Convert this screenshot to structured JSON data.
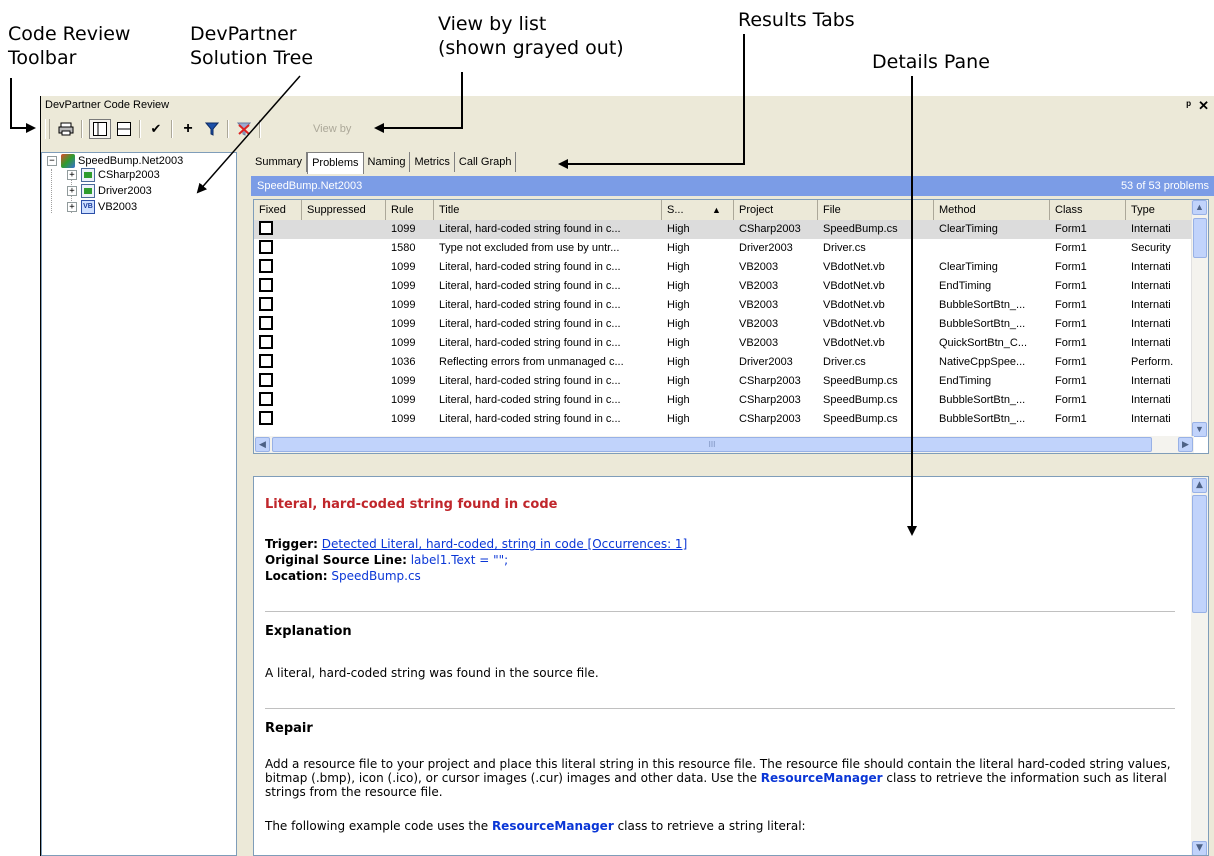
{
  "callouts": {
    "toolbar": [
      "Code Review",
      "Toolbar"
    ],
    "tree": [
      "DevPartner",
      "Solution Tree"
    ],
    "viewby": [
      "View by list",
      "(shown grayed out)"
    ],
    "tabs": "Results Tabs",
    "details": "Details Pane"
  },
  "window": {
    "title": "DevPartner Code Review",
    "pin_glyph": "ᵖ",
    "close_glyph": "✕"
  },
  "toolbar": {
    "view_by_label": "View by",
    "icons": [
      "printer-icon",
      "split-vertical-icon",
      "split-horizontal-icon",
      "checkmark-icon",
      "plus-icon",
      "filter-icon",
      "clear-filter-icon"
    ]
  },
  "tree": {
    "root": "SpeedBump.Net2003",
    "children": [
      "CSharp2003",
      "Driver2003",
      "VB2003"
    ]
  },
  "tabs": [
    "Summary",
    "Problems",
    "Naming",
    "Metrics",
    "Call Graph"
  ],
  "active_tab": "Problems",
  "band": {
    "left": "SpeedBump.Net2003",
    "right": "53 of 53 problems"
  },
  "grid": {
    "columns": [
      "Fixed",
      "Suppressed",
      "Rule",
      "Title",
      "S...",
      "Project",
      "File",
      "Method",
      "Class",
      "Type"
    ],
    "sort_indicator": "▲",
    "rows": [
      {
        "rule": "1099",
        "title": "Literal, hard-coded string found in c...",
        "sev": "High",
        "project": "CSharp2003",
        "file": "SpeedBump.cs",
        "method": "ClearTiming",
        "class": "Form1",
        "type": "Internati"
      },
      {
        "rule": "1580",
        "title": "Type not excluded from use by untr...",
        "sev": "High",
        "project": "Driver2003",
        "file": "Driver.cs",
        "method": "",
        "class": "Form1",
        "type": "Security"
      },
      {
        "rule": "1099",
        "title": "Literal, hard-coded string found in c...",
        "sev": "High",
        "project": "VB2003",
        "file": "VBdotNet.vb",
        "method": "ClearTiming",
        "class": "Form1",
        "type": "Internati"
      },
      {
        "rule": "1099",
        "title": "Literal, hard-coded string found in c...",
        "sev": "High",
        "project": "VB2003",
        "file": "VBdotNet.vb",
        "method": "EndTiming",
        "class": "Form1",
        "type": "Internati"
      },
      {
        "rule": "1099",
        "title": "Literal, hard-coded string found in c...",
        "sev": "High",
        "project": "VB2003",
        "file": "VBdotNet.vb",
        "method": "BubbleSortBtn_...",
        "class": "Form1",
        "type": "Internati"
      },
      {
        "rule": "1099",
        "title": "Literal, hard-coded string found in c...",
        "sev": "High",
        "project": "VB2003",
        "file": "VBdotNet.vb",
        "method": "BubbleSortBtn_...",
        "class": "Form1",
        "type": "Internati"
      },
      {
        "rule": "1099",
        "title": "Literal, hard-coded string found in c...",
        "sev": "High",
        "project": "VB2003",
        "file": "VBdotNet.vb",
        "method": "QuickSortBtn_C...",
        "class": "Form1",
        "type": "Internati"
      },
      {
        "rule": "1036",
        "title": "Reflecting errors from unmanaged c...",
        "sev": "High",
        "project": "Driver2003",
        "file": "Driver.cs",
        "method": "NativeCppSpee...",
        "class": "Form1",
        "type": "Perform."
      },
      {
        "rule": "1099",
        "title": "Literal, hard-coded string found in c...",
        "sev": "High",
        "project": "CSharp2003",
        "file": "SpeedBump.cs",
        "method": "EndTiming",
        "class": "Form1",
        "type": "Internati"
      },
      {
        "rule": "1099",
        "title": "Literal, hard-coded string found in c...",
        "sev": "High",
        "project": "CSharp2003",
        "file": "SpeedBump.cs",
        "method": "BubbleSortBtn_...",
        "class": "Form1",
        "type": "Internati"
      },
      {
        "rule": "1099",
        "title": "Literal, hard-coded string found in c...",
        "sev": "High",
        "project": "CSharp2003",
        "file": "SpeedBump.cs",
        "method": "BubbleSortBtn_...",
        "class": "Form1",
        "type": "Internati"
      }
    ],
    "hscroll_grip": "III"
  },
  "details": {
    "title": "Literal, hard-coded string found in code",
    "trigger_label": "Trigger:",
    "trigger_link": "Detected Literal, hard-coded, string in code [Occurrences: 1]",
    "source_label": "Original Source Line:",
    "source_value": "label1.Text = \"\";",
    "location_label": "Location:",
    "location_value": "SpeedBump.cs",
    "explanation_heading": "Explanation",
    "explanation_text": "A literal, hard-coded string was found in the source file.",
    "repair_heading": "Repair",
    "repair_text_1": "Add a resource file to your project and place this literal string in this resource file. The resource file should contain the literal hard-coded string values, bitmap (.bmp), icon (.ico), or cursor images (.cur) images and other data. Use the ",
    "repair_bold_1": "ResourceManager",
    "repair_text_2": " class to retrieve the information such as literal strings from the resource file.",
    "example_text_1": "The following example code uses the ",
    "example_bold": "ResourceManager",
    "example_text_2": " class to retrieve a string literal:"
  }
}
